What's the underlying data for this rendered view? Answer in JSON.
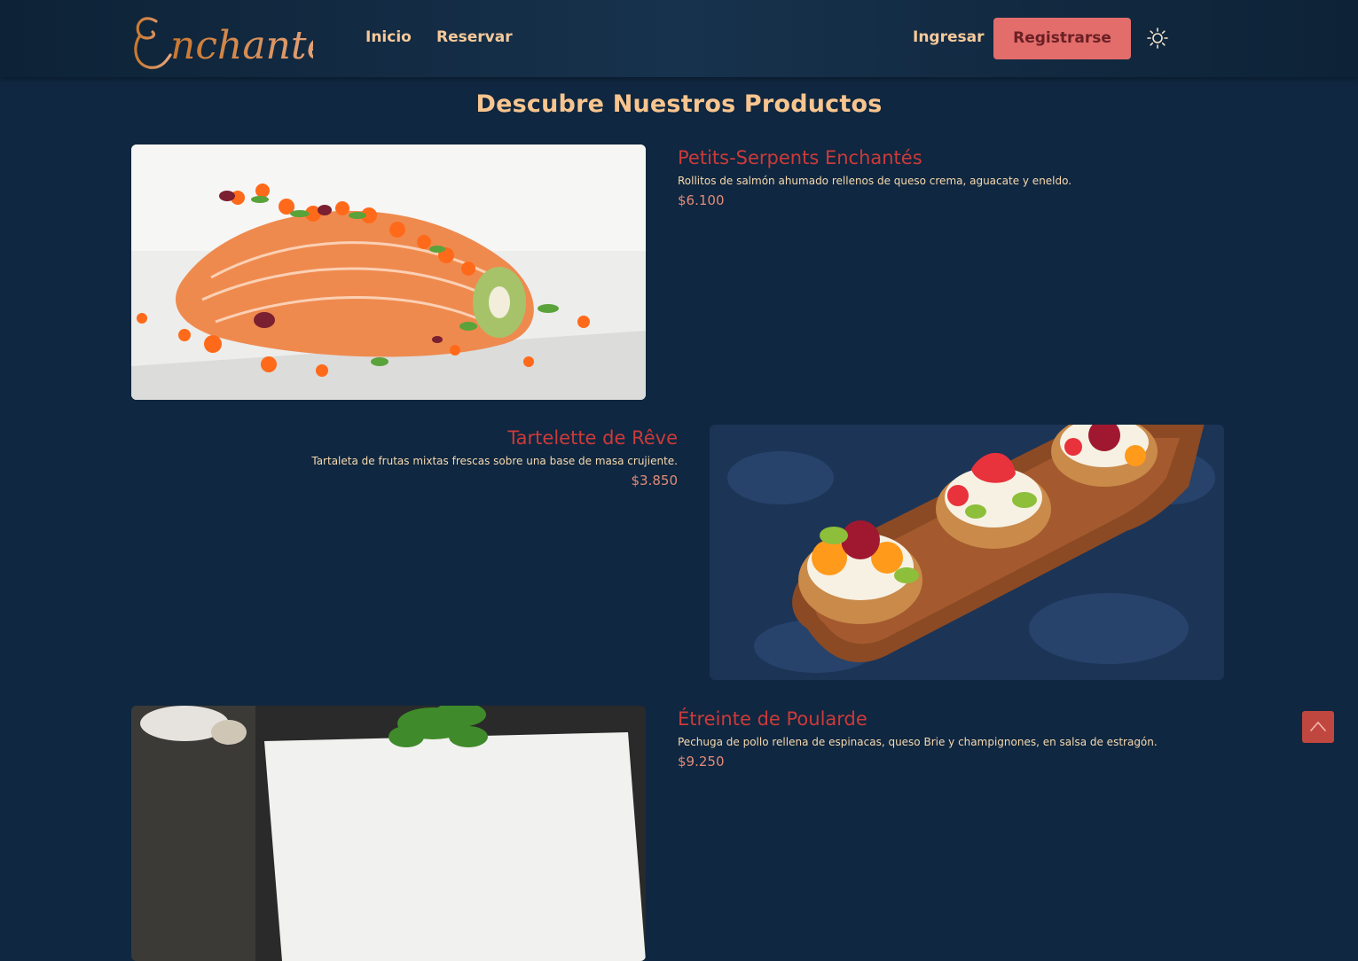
{
  "brand": {
    "logo_text": "Enchanté"
  },
  "nav": {
    "inicio": "Inicio",
    "reservar": "Reservar",
    "ingresar": "Ingresar",
    "registrarse": "Registrarse",
    "theme_toggle_icon": "sun-icon"
  },
  "main": {
    "title": "Descubre Nuestros Productos",
    "products": [
      {
        "name": "Petits-Serpents Enchantés",
        "description": "Rollitos de salmón ahumado rellenos de queso crema, aguacate y eneldo.",
        "price": "$6.100"
      },
      {
        "name": "Tartelette de Rêve",
        "description": "Tartaleta de frutas mixtas frescas sobre una base de masa crujiente.",
        "price": "$3.850"
      },
      {
        "name": "Étreinte de Poularde",
        "description": "Pechuga de pollo rellena de espinacas, queso Brie y champignones, en salsa de estragón.",
        "price": "$9.250"
      }
    ]
  },
  "scroll_top_icon": "chevron-up-icon",
  "colors": {
    "background": "#0f2740",
    "accent": "#e26d6b",
    "title": "#f8c58f",
    "product_name": "#cd3a3a",
    "price": "#e38a78"
  }
}
